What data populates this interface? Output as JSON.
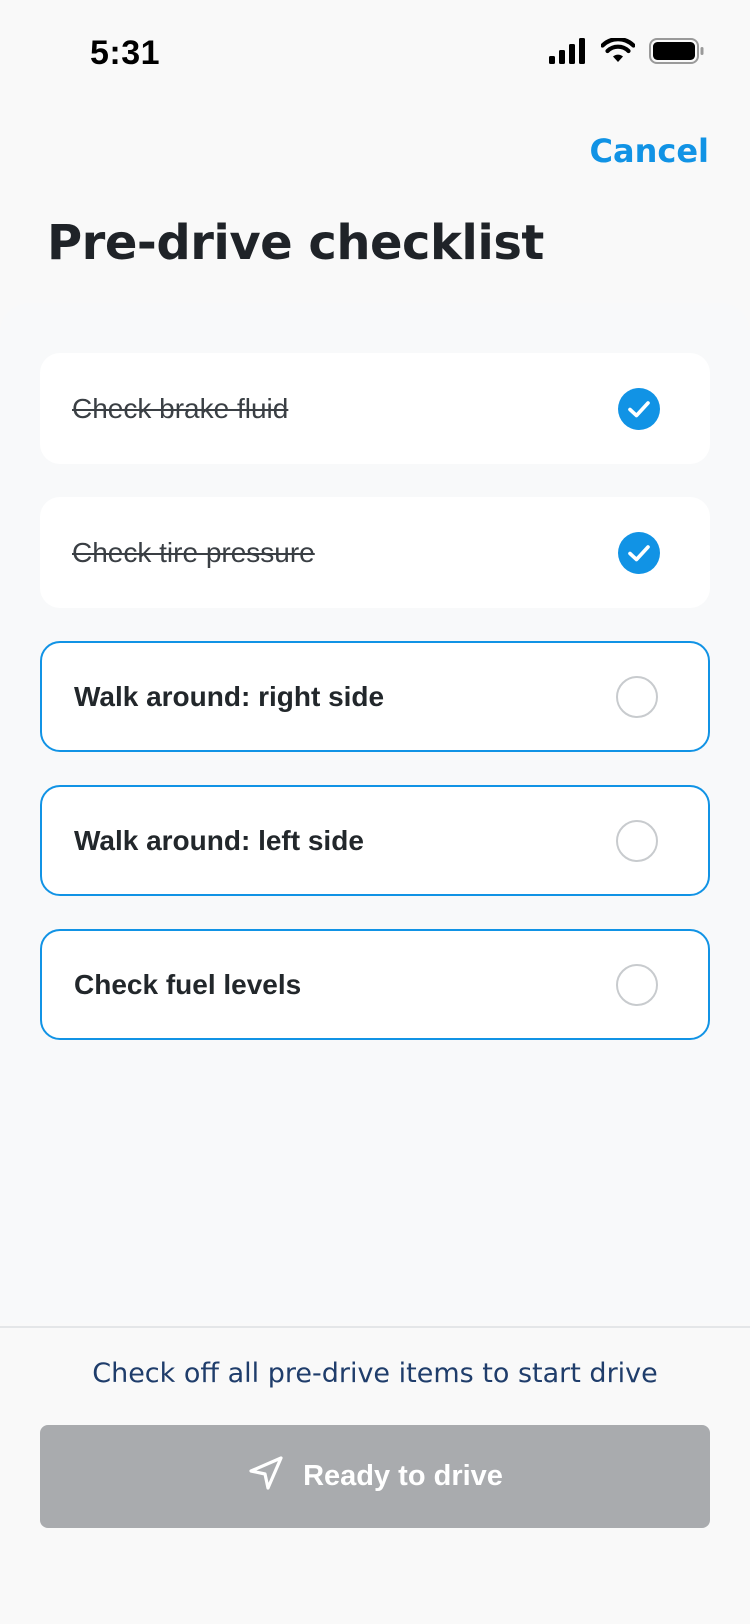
{
  "status_bar": {
    "time": "5:31",
    "icons": [
      "cellular-signal-icon",
      "wifi-icon",
      "battery-icon"
    ]
  },
  "header": {
    "cancel_label": "Cancel",
    "title": "Pre-drive checklist"
  },
  "checklist": {
    "items": [
      {
        "label": "Check brake fluid",
        "checked": true
      },
      {
        "label": "Check tire pressure",
        "checked": true
      },
      {
        "label": "Walk around: right side",
        "checked": false
      },
      {
        "label": "Walk around: left side",
        "checked": false
      },
      {
        "label": "Check fuel levels",
        "checked": false
      }
    ]
  },
  "footer": {
    "hint": "Check off all pre-drive items to start drive",
    "drive_button_label": "Ready to drive",
    "drive_button_icon": "navigation-arrow-icon",
    "drive_button_disabled": true
  },
  "colors": {
    "accent": "#1193e5",
    "disabled": "#a9abae",
    "hint_text": "#1f3d6b"
  }
}
